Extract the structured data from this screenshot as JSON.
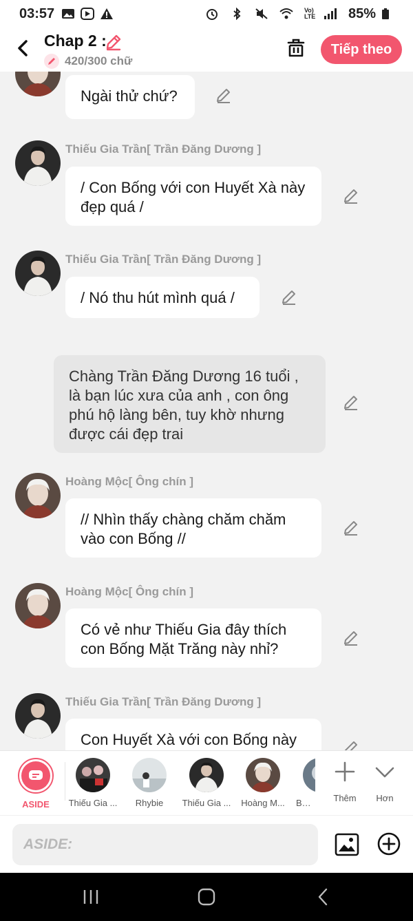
{
  "status_bar": {
    "time": "03:57",
    "battery": "85%",
    "network": "Vo) LTE"
  },
  "header": {
    "title": "Chap 2 :",
    "word_count": "420/300 chữ",
    "next_button": "Tiếp theo"
  },
  "messages": [
    {
      "type": "dialog",
      "speaker": "",
      "avatar": "old-man",
      "text": "Ngài thử chứ?"
    },
    {
      "type": "dialog",
      "speaker": "Thiếu Gia Trần[ Trần Đăng Dương ]",
      "avatar": "young-man",
      "text": "/ Con Bống với con Huyết Xà này đẹp quá /"
    },
    {
      "type": "dialog",
      "speaker": "Thiếu Gia Trần[ Trần Đăng Dương ]",
      "avatar": "young-man",
      "text": "/ Nó thu hút mình quá /"
    },
    {
      "type": "aside",
      "text": "Chàng Trần Đăng Dương 16 tuổi , là bạn lúc xưa của anh , con ông phú hộ làng bên, tuy khờ nhưng được cái đẹp trai"
    },
    {
      "type": "dialog",
      "speaker": "Hoàng Mộc[ Ông chín ]",
      "avatar": "old-man",
      "text": "// Nhìn thấy chàng chăm chăm vào con Bống //"
    },
    {
      "type": "dialog",
      "speaker": "Hoàng Mộc[ Ông chín ]",
      "avatar": "old-man",
      "text": "Có vẻ như Thiếu Gia đây thích con Bống Mặt Trăng này nhỉ?"
    },
    {
      "type": "dialog",
      "speaker": "Thiếu Gia Trần[ Trần Đăng Dương ]",
      "avatar": "young-man",
      "text": "Con Huyết Xà với con Bống này"
    }
  ],
  "characters": [
    {
      "label": "ASIDE",
      "selected": true
    },
    {
      "label": "Thiếu Gia ...",
      "avatar": "group-photo"
    },
    {
      "label": "Rhybie",
      "avatar": "room-photo"
    },
    {
      "label": "Thiếu Gia ...",
      "avatar": "young-man"
    },
    {
      "label": "Hoàng M...",
      "avatar": "old-man"
    },
    {
      "label": "Bống",
      "avatar": "partial"
    }
  ],
  "tools": {
    "add_label": "Thêm",
    "more_label": "Hơn"
  },
  "input": {
    "placeholder": "ASIDE:"
  },
  "colors": {
    "accent": "#f2566e",
    "background": "#f2f2f2",
    "bubble": "#ffffff",
    "aside_bubble": "#e6e6e6"
  }
}
